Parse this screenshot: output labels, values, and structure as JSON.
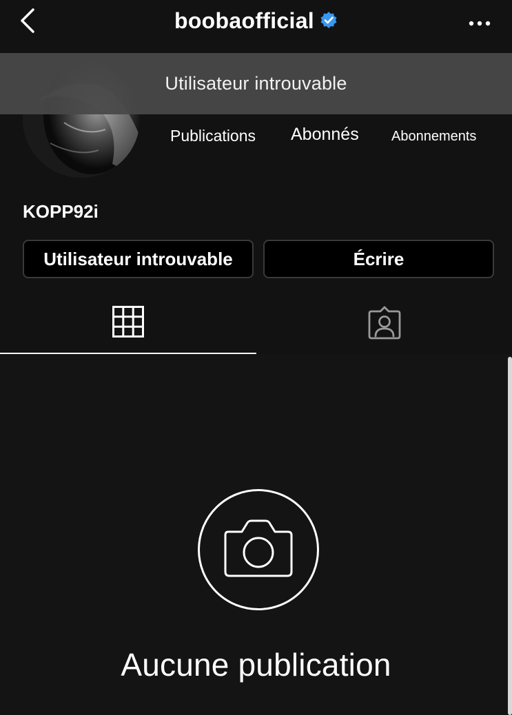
{
  "header": {
    "title": "boobaofficial",
    "verified": true,
    "back_icon": "chevron-left-icon",
    "more_icon": "more-horizontal-icon"
  },
  "banner": {
    "text": "Utilisateur introuvable"
  },
  "profile": {
    "stats": {
      "publications_label": "Publications",
      "abonnes_label": "Abonnés",
      "abonnements_label": "Abonnements"
    },
    "username": "KOPP92i"
  },
  "actions": {
    "primary_label": "Utilisateur introuvable",
    "message_label": "Écrire"
  },
  "tabs": {
    "grid_icon": "grid-icon",
    "tagged_icon": "tagged-person-icon",
    "active": "grid"
  },
  "empty_state": {
    "icon": "camera-icon",
    "text": "Aucune publication"
  },
  "colors": {
    "background": "#121212",
    "banner": "#484848",
    "verified": "#3897f0",
    "button_border": "#3a3a3a"
  }
}
